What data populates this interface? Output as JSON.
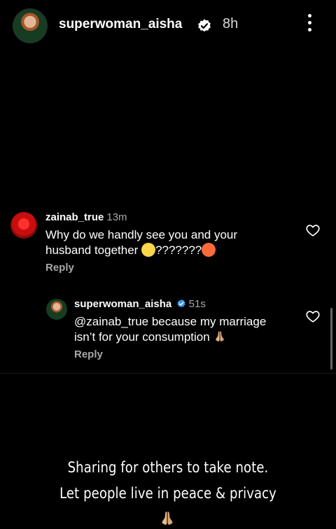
{
  "story": {
    "username": "superwoman_aisha",
    "time": "8h",
    "avatar_icon": "profile-avatar-icon",
    "more_icon": "more-vertical-icon",
    "verified_icon": "verified-badge-icon"
  },
  "comments": [
    {
      "username": "zainab_true",
      "time": "13m",
      "text_line1": "Why do we handly see you and your",
      "text_line2_prefix": "husband together ",
      "text_line2_mid": "???????",
      "reply_label": "Reply"
    },
    {
      "username": "superwoman_aisha",
      "time": "51s",
      "text_line1": "@zainab_true because my marriage",
      "text_line2": "isn’t for your consumption ",
      "reply_label": "Reply"
    }
  ],
  "caption": {
    "line1": "Sharing for others to take note.",
    "line2": "Let people live  in peace & privacy"
  },
  "colors": {
    "background": "#000000",
    "secondary_text": "#a8a8a8",
    "verified_blue": "#3897f0"
  }
}
